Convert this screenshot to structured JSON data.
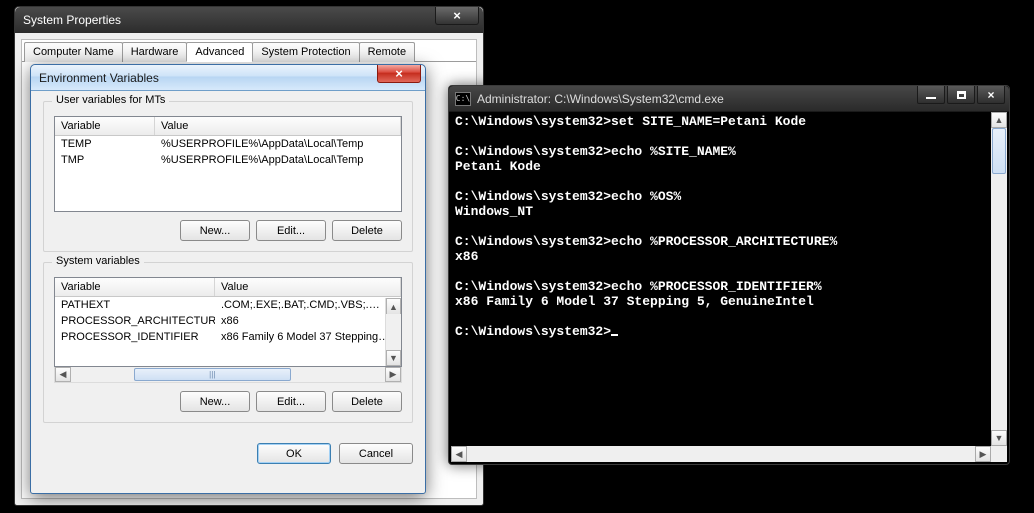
{
  "sysprops": {
    "title": "System Properties",
    "close_glyph": "×",
    "tabs": [
      {
        "label": "Computer Name"
      },
      {
        "label": "Hardware"
      },
      {
        "label": "Advanced"
      },
      {
        "label": "System Protection"
      },
      {
        "label": "Remote"
      }
    ],
    "active_tab": 2
  },
  "envdlg": {
    "title": "Environment Variables",
    "close_glyph": "×",
    "user": {
      "legend": "User variables for MTs",
      "headers": {
        "var": "Variable",
        "val": "Value"
      },
      "rows": [
        {
          "var": "TEMP",
          "val": "%USERPROFILE%\\AppData\\Local\\Temp"
        },
        {
          "var": "TMP",
          "val": "%USERPROFILE%\\AppData\\Local\\Temp"
        }
      ],
      "buttons": {
        "new": "New...",
        "edit": "Edit...",
        "del": "Delete"
      }
    },
    "system": {
      "legend": "System variables",
      "headers": {
        "var": "Variable",
        "val": "Value"
      },
      "rows": [
        {
          "var": "PATHEXT",
          "val": ".COM;.EXE;.BAT;.CMD;.VBS;.…"
        },
        {
          "var": "PROCESSOR_ARCHITECTURE",
          "val": "x86"
        },
        {
          "var": "PROCESSOR_IDENTIFIER",
          "val": "x86 Family 6 Model 37 Stepping…"
        }
      ],
      "buttons": {
        "new": "New...",
        "edit": "Edit...",
        "del": "Delete"
      }
    },
    "dialog_buttons": {
      "ok": "OK",
      "cancel": "Cancel"
    },
    "scroll_grip": "|||"
  },
  "cmd": {
    "icon_text": "C:\\",
    "title": "Administrator: C:\\Windows\\System32\\cmd.exe",
    "close_glyph": "×",
    "lines": [
      "C:\\Windows\\system32>set SITE_NAME=Petani Kode",
      "",
      "C:\\Windows\\system32>echo %SITE_NAME%",
      "Petani Kode",
      "",
      "C:\\Windows\\system32>echo %OS%",
      "Windows_NT",
      "",
      "C:\\Windows\\system32>echo %PROCESSOR_ARCHITECTURE%",
      "x86",
      "",
      "C:\\Windows\\system32>echo %PROCESSOR_IDENTIFIER%",
      "x86 Family 6 Model 37 Stepping 5, GenuineIntel",
      "",
      "C:\\Windows\\system32>"
    ],
    "scroll": {
      "up": "▲",
      "down": "▼",
      "left": "◀",
      "right": "▶"
    }
  }
}
